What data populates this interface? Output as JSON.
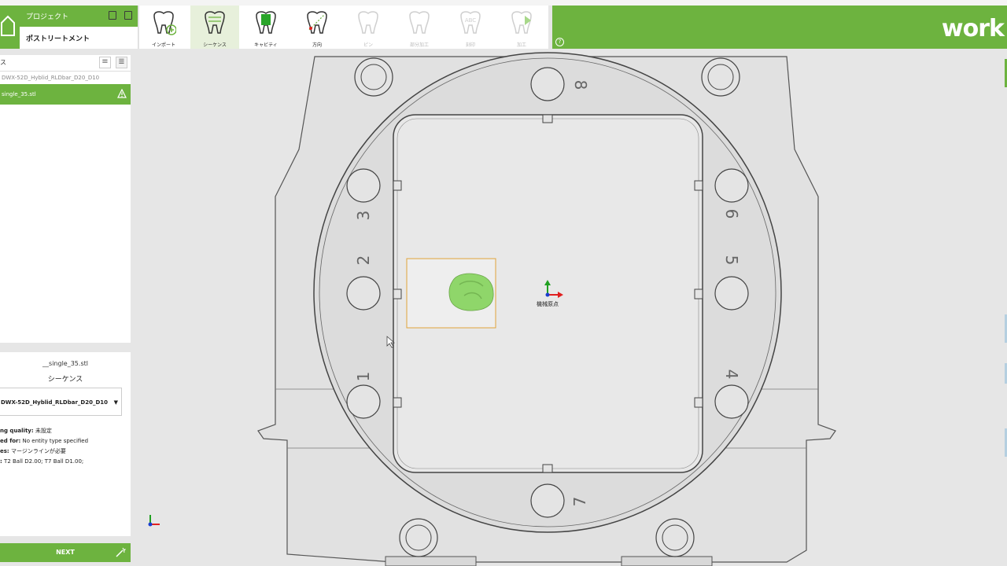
{
  "header": {
    "project_label": "プロジェクト",
    "project_name": "ポストリートメント",
    "brand": "work",
    "help": "?"
  },
  "steps": [
    {
      "label": "インポート",
      "state": "normal"
    },
    {
      "label": "シーケンス",
      "state": "active"
    },
    {
      "label": "キャビティ",
      "state": "normal"
    },
    {
      "label": "方向",
      "state": "normal"
    },
    {
      "label": "ピン",
      "state": "disabled"
    },
    {
      "label": "部分加工",
      "state": "disabled"
    },
    {
      "label": "刻印",
      "state": "disabled"
    },
    {
      "label": "加工",
      "state": "disabled"
    }
  ],
  "leftpanel": {
    "search_text": "ス",
    "tree_parent": "DWX-52D_Hyblid_RLDbar_D20_D10",
    "tree_selected": "single_35.stl"
  },
  "info": {
    "file": "__single_35.stl",
    "section": "シーケンス",
    "sequence_value": "DWX-52D_Hyblid_RLDbar_D20_D10",
    "quality_label": "ng quality:",
    "quality_value": "未設定",
    "used_label": "ed for:",
    "used_value": "No entity type specified",
    "notes_label": "es:",
    "notes_value": "マージンラインが必要",
    "tools_label": ":",
    "tools_value": "T2 Ball D2.00; T7 Ball D1.00;",
    "next_label": "NEXT"
  },
  "viewport": {
    "origin_label": "機械原点",
    "slot_numbers": [
      "8",
      "3",
      "2",
      "1",
      "6",
      "5",
      "4",
      "7"
    ]
  },
  "colors": {
    "accent": "#6db33f",
    "tooth": "#8fd66a"
  }
}
